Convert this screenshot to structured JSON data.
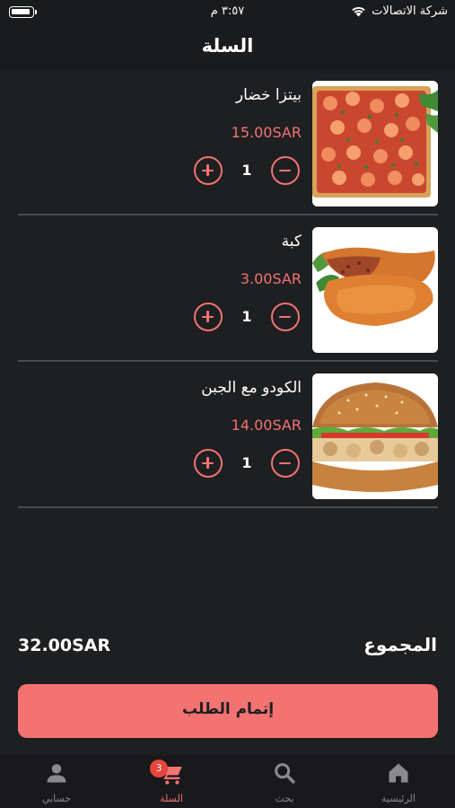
{
  "status_bar": {
    "carrier": "شركة الاتصالات",
    "time": "٣:٥٧ م"
  },
  "header": {
    "title": "السلة"
  },
  "cart": {
    "items": [
      {
        "name": "بيتزا خضار",
        "price": "15.00SAR",
        "quantity": "1"
      },
      {
        "name": "كبة",
        "price": "3.00SAR",
        "quantity": "1"
      },
      {
        "name": "الكودو مع الجبن",
        "price": "14.00SAR",
        "quantity": "1"
      }
    ]
  },
  "summary": {
    "total_label": "المجموع",
    "total_value": "32.00SAR"
  },
  "checkout": {
    "label": "إتمام الطلب"
  },
  "bottom_nav": {
    "items": [
      {
        "label": "الرئيسية",
        "icon": "home-icon"
      },
      {
        "label": "بحث",
        "icon": "search-icon"
      },
      {
        "label": "السلة",
        "icon": "cart-icon",
        "badge": "3",
        "active": true
      },
      {
        "label": "حسابي",
        "icon": "person-icon"
      }
    ]
  },
  "colors": {
    "accent": "#f37373",
    "background": "#1e1f21",
    "divider": "#4a4b4d",
    "badge": "#e8453c"
  }
}
